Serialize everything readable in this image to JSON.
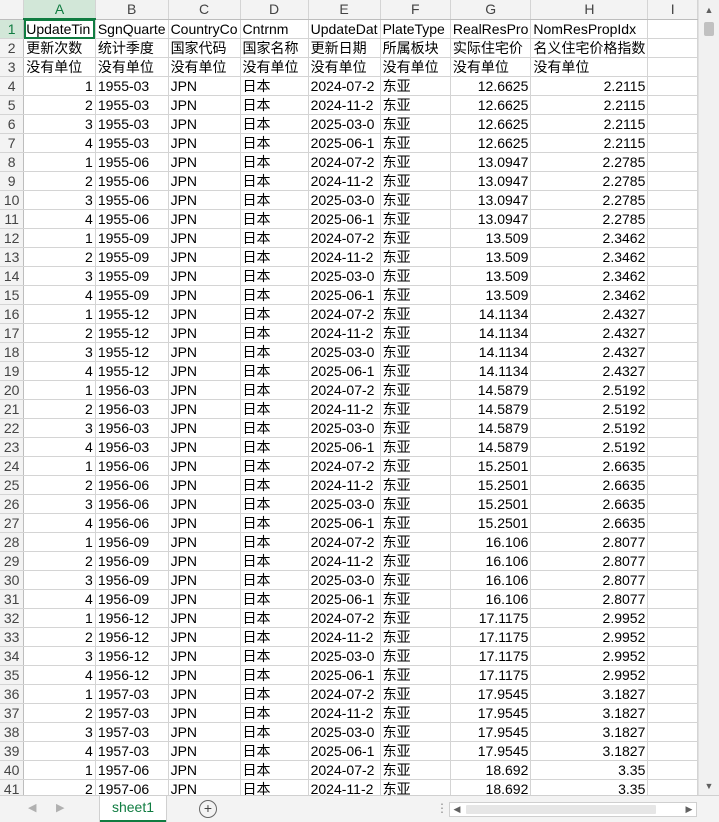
{
  "columns": [
    "A",
    "B",
    "C",
    "D",
    "E",
    "F",
    "G",
    "H",
    "I"
  ],
  "header_rows": [
    {
      "num": "1",
      "cells": [
        "UpdateTin",
        "SgnQuarte",
        "CountryCo",
        "Cntrnm",
        "UpdateDat",
        "PlateType",
        "RealResPro",
        "NomResPropIdx",
        ""
      ]
    },
    {
      "num": "2",
      "cells": [
        "更新次数",
        "统计季度",
        "国家代码",
        "国家名称",
        "更新日期",
        "所属板块",
        "实际住宅价",
        "名义住宅价格指数",
        ""
      ]
    },
    {
      "num": "3",
      "cells": [
        "没有单位",
        "没有单位",
        "没有单位",
        "没有单位",
        "没有单位",
        "没有单位",
        "没有单位",
        "没有单位",
        ""
      ]
    }
  ],
  "data_rows": [
    {
      "num": "4",
      "a": "1",
      "b": "1955-03",
      "c": "JPN",
      "d": "日本",
      "e": "2024-07-2",
      "f": "东亚",
      "g": "12.6625",
      "h": "2.2115"
    },
    {
      "num": "5",
      "a": "2",
      "b": "1955-03",
      "c": "JPN",
      "d": "日本",
      "e": "2024-11-2",
      "f": "东亚",
      "g": "12.6625",
      "h": "2.2115"
    },
    {
      "num": "6",
      "a": "3",
      "b": "1955-03",
      "c": "JPN",
      "d": "日本",
      "e": "2025-03-0",
      "f": "东亚",
      "g": "12.6625",
      "h": "2.2115"
    },
    {
      "num": "7",
      "a": "4",
      "b": "1955-03",
      "c": "JPN",
      "d": "日本",
      "e": "2025-06-1",
      "f": "东亚",
      "g": "12.6625",
      "h": "2.2115"
    },
    {
      "num": "8",
      "a": "1",
      "b": "1955-06",
      "c": "JPN",
      "d": "日本",
      "e": "2024-07-2",
      "f": "东亚",
      "g": "13.0947",
      "h": "2.2785"
    },
    {
      "num": "9",
      "a": "2",
      "b": "1955-06",
      "c": "JPN",
      "d": "日本",
      "e": "2024-11-2",
      "f": "东亚",
      "g": "13.0947",
      "h": "2.2785"
    },
    {
      "num": "10",
      "a": "3",
      "b": "1955-06",
      "c": "JPN",
      "d": "日本",
      "e": "2025-03-0",
      "f": "东亚",
      "g": "13.0947",
      "h": "2.2785"
    },
    {
      "num": "11",
      "a": "4",
      "b": "1955-06",
      "c": "JPN",
      "d": "日本",
      "e": "2025-06-1",
      "f": "东亚",
      "g": "13.0947",
      "h": "2.2785"
    },
    {
      "num": "12",
      "a": "1",
      "b": "1955-09",
      "c": "JPN",
      "d": "日本",
      "e": "2024-07-2",
      "f": "东亚",
      "g": "13.509",
      "h": "2.3462"
    },
    {
      "num": "13",
      "a": "2",
      "b": "1955-09",
      "c": "JPN",
      "d": "日本",
      "e": "2024-11-2",
      "f": "东亚",
      "g": "13.509",
      "h": "2.3462"
    },
    {
      "num": "14",
      "a": "3",
      "b": "1955-09",
      "c": "JPN",
      "d": "日本",
      "e": "2025-03-0",
      "f": "东亚",
      "g": "13.509",
      "h": "2.3462"
    },
    {
      "num": "15",
      "a": "4",
      "b": "1955-09",
      "c": "JPN",
      "d": "日本",
      "e": "2025-06-1",
      "f": "东亚",
      "g": "13.509",
      "h": "2.3462"
    },
    {
      "num": "16",
      "a": "1",
      "b": "1955-12",
      "c": "JPN",
      "d": "日本",
      "e": "2024-07-2",
      "f": "东亚",
      "g": "14.1134",
      "h": "2.4327"
    },
    {
      "num": "17",
      "a": "2",
      "b": "1955-12",
      "c": "JPN",
      "d": "日本",
      "e": "2024-11-2",
      "f": "东亚",
      "g": "14.1134",
      "h": "2.4327"
    },
    {
      "num": "18",
      "a": "3",
      "b": "1955-12",
      "c": "JPN",
      "d": "日本",
      "e": "2025-03-0",
      "f": "东亚",
      "g": "14.1134",
      "h": "2.4327"
    },
    {
      "num": "19",
      "a": "4",
      "b": "1955-12",
      "c": "JPN",
      "d": "日本",
      "e": "2025-06-1",
      "f": "东亚",
      "g": "14.1134",
      "h": "2.4327"
    },
    {
      "num": "20",
      "a": "1",
      "b": "1956-03",
      "c": "JPN",
      "d": "日本",
      "e": "2024-07-2",
      "f": "东亚",
      "g": "14.5879",
      "h": "2.5192"
    },
    {
      "num": "21",
      "a": "2",
      "b": "1956-03",
      "c": "JPN",
      "d": "日本",
      "e": "2024-11-2",
      "f": "东亚",
      "g": "14.5879",
      "h": "2.5192"
    },
    {
      "num": "22",
      "a": "3",
      "b": "1956-03",
      "c": "JPN",
      "d": "日本",
      "e": "2025-03-0",
      "f": "东亚",
      "g": "14.5879",
      "h": "2.5192"
    },
    {
      "num": "23",
      "a": "4",
      "b": "1956-03",
      "c": "JPN",
      "d": "日本",
      "e": "2025-06-1",
      "f": "东亚",
      "g": "14.5879",
      "h": "2.5192"
    },
    {
      "num": "24",
      "a": "1",
      "b": "1956-06",
      "c": "JPN",
      "d": "日本",
      "e": "2024-07-2",
      "f": "东亚",
      "g": "15.2501",
      "h": "2.6635"
    },
    {
      "num": "25",
      "a": "2",
      "b": "1956-06",
      "c": "JPN",
      "d": "日本",
      "e": "2024-11-2",
      "f": "东亚",
      "g": "15.2501",
      "h": "2.6635"
    },
    {
      "num": "26",
      "a": "3",
      "b": "1956-06",
      "c": "JPN",
      "d": "日本",
      "e": "2025-03-0",
      "f": "东亚",
      "g": "15.2501",
      "h": "2.6635"
    },
    {
      "num": "27",
      "a": "4",
      "b": "1956-06",
      "c": "JPN",
      "d": "日本",
      "e": "2025-06-1",
      "f": "东亚",
      "g": "15.2501",
      "h": "2.6635"
    },
    {
      "num": "28",
      "a": "1",
      "b": "1956-09",
      "c": "JPN",
      "d": "日本",
      "e": "2024-07-2",
      "f": "东亚",
      "g": "16.106",
      "h": "2.8077"
    },
    {
      "num": "29",
      "a": "2",
      "b": "1956-09",
      "c": "JPN",
      "d": "日本",
      "e": "2024-11-2",
      "f": "东亚",
      "g": "16.106",
      "h": "2.8077"
    },
    {
      "num": "30",
      "a": "3",
      "b": "1956-09",
      "c": "JPN",
      "d": "日本",
      "e": "2025-03-0",
      "f": "东亚",
      "g": "16.106",
      "h": "2.8077"
    },
    {
      "num": "31",
      "a": "4",
      "b": "1956-09",
      "c": "JPN",
      "d": "日本",
      "e": "2025-06-1",
      "f": "东亚",
      "g": "16.106",
      "h": "2.8077"
    },
    {
      "num": "32",
      "a": "1",
      "b": "1956-12",
      "c": "JPN",
      "d": "日本",
      "e": "2024-07-2",
      "f": "东亚",
      "g": "17.1175",
      "h": "2.9952"
    },
    {
      "num": "33",
      "a": "2",
      "b": "1956-12",
      "c": "JPN",
      "d": "日本",
      "e": "2024-11-2",
      "f": "东亚",
      "g": "17.1175",
      "h": "2.9952"
    },
    {
      "num": "34",
      "a": "3",
      "b": "1956-12",
      "c": "JPN",
      "d": "日本",
      "e": "2025-03-0",
      "f": "东亚",
      "g": "17.1175",
      "h": "2.9952"
    },
    {
      "num": "35",
      "a": "4",
      "b": "1956-12",
      "c": "JPN",
      "d": "日本",
      "e": "2025-06-1",
      "f": "东亚",
      "g": "17.1175",
      "h": "2.9952"
    },
    {
      "num": "36",
      "a": "1",
      "b": "1957-03",
      "c": "JPN",
      "d": "日本",
      "e": "2024-07-2",
      "f": "东亚",
      "g": "17.9545",
      "h": "3.1827"
    },
    {
      "num": "37",
      "a": "2",
      "b": "1957-03",
      "c": "JPN",
      "d": "日本",
      "e": "2024-11-2",
      "f": "东亚",
      "g": "17.9545",
      "h": "3.1827"
    },
    {
      "num": "38",
      "a": "3",
      "b": "1957-03",
      "c": "JPN",
      "d": "日本",
      "e": "2025-03-0",
      "f": "东亚",
      "g": "17.9545",
      "h": "3.1827"
    },
    {
      "num": "39",
      "a": "4",
      "b": "1957-03",
      "c": "JPN",
      "d": "日本",
      "e": "2025-06-1",
      "f": "东亚",
      "g": "17.9545",
      "h": "3.1827"
    },
    {
      "num": "40",
      "a": "1",
      "b": "1957-06",
      "c": "JPN",
      "d": "日本",
      "e": "2024-07-2",
      "f": "东亚",
      "g": "18.692",
      "h": "3.35"
    },
    {
      "num": "41",
      "a": "2",
      "b": "1957-06",
      "c": "JPN",
      "d": "日本",
      "e": "2024-11-2",
      "f": "东亚",
      "g": "18.692",
      "h": "3.35"
    }
  ],
  "sheet_tab": {
    "label": "sheet1"
  },
  "add_sheet_label": "+",
  "accent_color": "#107c41"
}
